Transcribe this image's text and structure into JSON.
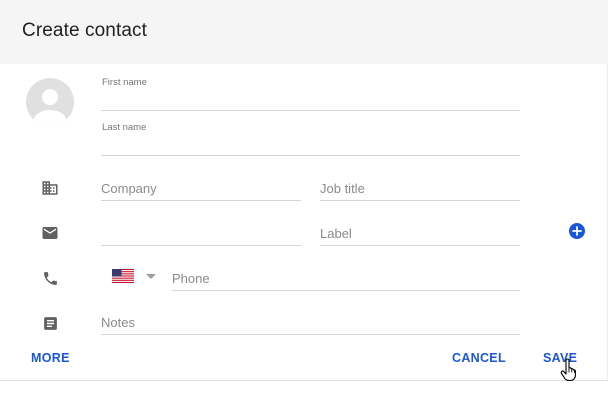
{
  "dialog": {
    "title": "Create contact"
  },
  "fields": {
    "first_name": {
      "label": "First name",
      "value": ""
    },
    "last_name": {
      "label": "Last name",
      "value": ""
    },
    "company": {
      "placeholder": "Company",
      "value": ""
    },
    "job_title": {
      "placeholder": "Job title",
      "value": ""
    },
    "email": {
      "placeholder": "",
      "value": ""
    },
    "email_label": {
      "placeholder": "Label",
      "value": ""
    },
    "phone": {
      "placeholder": "Phone",
      "value": "",
      "country": "us-flag"
    },
    "notes": {
      "placeholder": "Notes",
      "value": ""
    }
  },
  "icons": {
    "company": "building-icon",
    "email": "mail-icon",
    "phone": "phone-icon",
    "notes": "notes-icon",
    "add": "add-circle-icon"
  },
  "actions": {
    "more": "MORE",
    "cancel": "CANCEL",
    "save": "SAVE"
  },
  "colors": {
    "accent": "#1a56db",
    "header_bg": "#f5f5f5",
    "icon": "#616161"
  }
}
